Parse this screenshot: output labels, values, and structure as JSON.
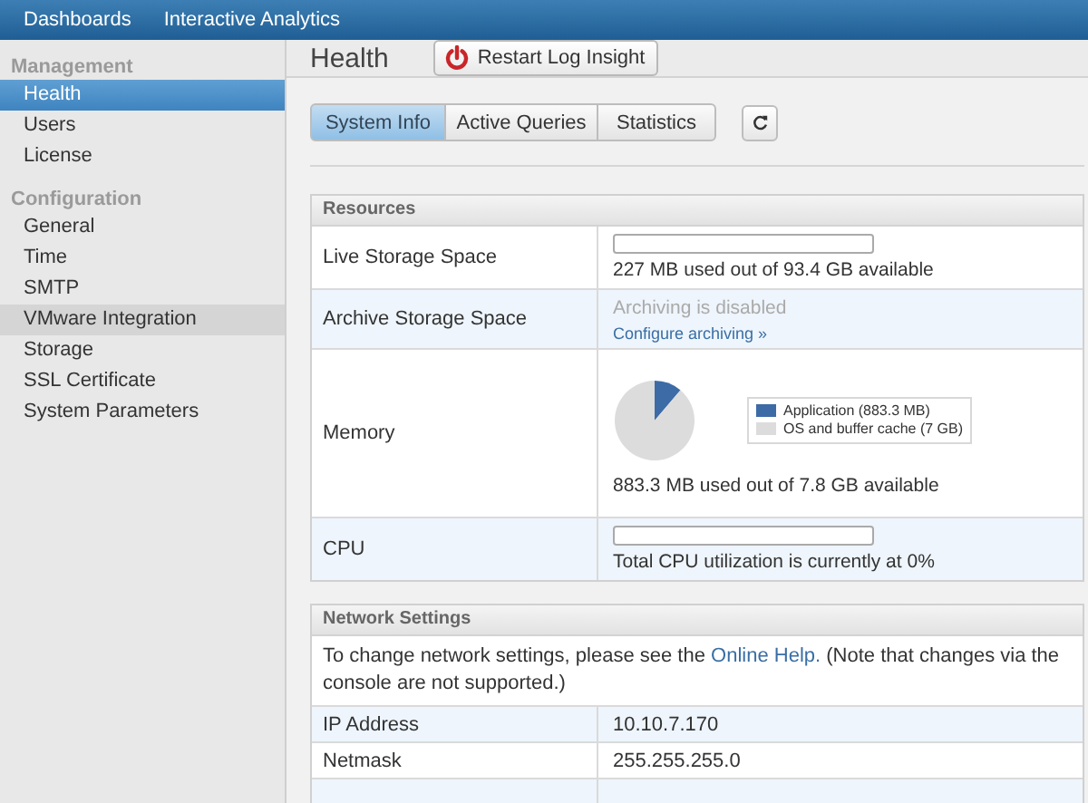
{
  "topnav": [
    {
      "label": "Dashboards"
    },
    {
      "label": "Interactive Analytics"
    }
  ],
  "sidebar": {
    "sections": [
      {
        "title": "Management",
        "items": [
          {
            "label": "Health",
            "selected": true,
            "hovered": false
          },
          {
            "label": "Users",
            "selected": false,
            "hovered": false
          },
          {
            "label": "License",
            "selected": false,
            "hovered": false
          }
        ]
      },
      {
        "title": "Configuration",
        "items": [
          {
            "label": "General",
            "selected": false,
            "hovered": false
          },
          {
            "label": "Time",
            "selected": false,
            "hovered": false
          },
          {
            "label": "SMTP",
            "selected": false,
            "hovered": false
          },
          {
            "label": "VMware Integration",
            "selected": false,
            "hovered": true
          },
          {
            "label": "Storage",
            "selected": false,
            "hovered": false
          },
          {
            "label": "SSL Certificate",
            "selected": false,
            "hovered": false
          },
          {
            "label": "System Parameters",
            "selected": false,
            "hovered": false
          }
        ]
      }
    ]
  },
  "page_title": "Health",
  "restart_button": "Restart Log Insight",
  "tabs": [
    {
      "label": "System Info",
      "selected": true
    },
    {
      "label": "Active Queries",
      "selected": false
    },
    {
      "label": "Statistics",
      "selected": false
    }
  ],
  "resources": {
    "title": "Resources",
    "rows": [
      {
        "kind": "meter",
        "label": "Live Storage Space",
        "level": 0.0,
        "reading": "227 MB used out of 93.4 GB available"
      },
      {
        "kind": "disabled",
        "label": "Archive Storage Space",
        "note": "Archiving is disabled",
        "link": "Configure archiving »"
      },
      {
        "kind": "pie",
        "label": "Memory",
        "reading": "883.3 MB used out of 7.8 GB available",
        "chart_data": {
          "type": "pie",
          "categories": [
            "Application (883.3 MB)",
            "OS and buffer cache (7 GB)"
          ],
          "values": [
            883.3,
            7000
          ],
          "colors": [
            "#3d6ba6",
            "#dcdcdc"
          ],
          "legend": true
        }
      },
      {
        "kind": "meter",
        "label": "CPU",
        "level": 0.0,
        "reading": "Total CPU utilization is currently at 0%"
      }
    ]
  },
  "network": {
    "title": "Network Settings",
    "note_before": "To change network settings, please see the ",
    "note_link": "Online Help.",
    "note_after": " (Note that changes via the console are not supported.)",
    "rows": [
      {
        "label": "IP Address",
        "value": "10.10.7.170"
      },
      {
        "label": "Netmask",
        "value": "255.255.255.0"
      }
    ]
  }
}
